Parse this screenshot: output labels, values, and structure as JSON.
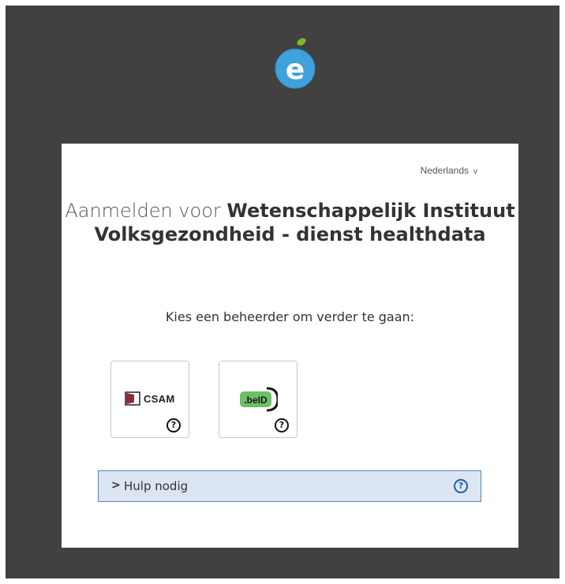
{
  "language": {
    "label": "Nederlands",
    "chevron": "v"
  },
  "heading": {
    "prefix": "Aanmelden voor",
    "organization": "Wetenschappelijk Instituut Volksgezondheid - dienst healthdata"
  },
  "subtitle": "Kies een beheerder om verder te gaan:",
  "providers": [
    {
      "name": "CSAM",
      "help": "?"
    },
    {
      "name": ".beID",
      "help": "?"
    }
  ],
  "help": {
    "label": "Hulp nodig",
    "chevron": ">",
    "icon": "?"
  },
  "colors": {
    "frame": "#434040",
    "help_bg": "#dce6f2",
    "help_border": "#5b86b4",
    "logo_blue": "#3fa2db",
    "logo_leaf": "#7cb82f",
    "beid_green": "#6fbe6b"
  }
}
